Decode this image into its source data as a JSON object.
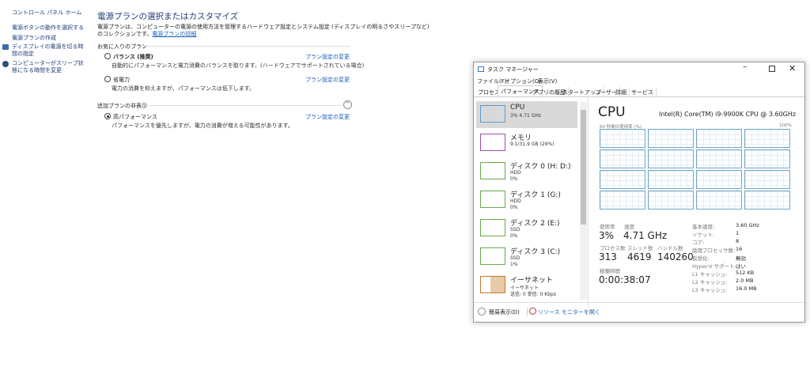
{
  "control_panel": {
    "sidebar": {
      "home": "コントロール パネル ホーム",
      "items": [
        "電源ボタンの動作を選択する",
        "電源プランの作成",
        "ディスプレイの電源を切る時間の指定",
        "コンピューターがスリープ状態になる時間を変更"
      ]
    },
    "title": "電源プランの選択またはカスタマイズ",
    "description": "電源プランは、コンピューターの電源の使用方法を管理するハードウェア設定とシステム設定 (ディスプレイの明るさやスリープなど)",
    "description2": "のコレクションです。",
    "details_link": "電源プランの詳細",
    "favorites_header": "お気に入りのプラン",
    "hidden_header": "追加プランの非表示",
    "change_link": "プラン設定の変更",
    "plans": [
      {
        "name": "バランス (推奨)",
        "desc": "自動的にパフォーマンスと電力消費のバランスを取ります。(ハードウェアでサポートされている場合)",
        "selected": false
      },
      {
        "name": "省電力",
        "desc": "電力の消費を抑えますが、パフォーマンスは低下します。",
        "selected": false
      },
      {
        "name": "高パフォーマンス",
        "desc": "パフォーマンスを優先しますが、電力の消費が増える可能性があります。",
        "selected": true
      }
    ]
  },
  "task_manager": {
    "title": "タスク マネージャー",
    "menu": [
      "ファイル(F)",
      "オプション(O)",
      "表示(V)"
    ],
    "tabs": [
      "プロセス",
      "パフォーマンス",
      "アプリの履歴",
      "スタートアップ",
      "ユーザー",
      "詳細",
      "サービス"
    ],
    "active_tab": "パフォーマンス",
    "resources": [
      {
        "name": "CPU",
        "sub1": "3% 4.71 GHz",
        "sub2": "",
        "color": "#5b9bc8"
      },
      {
        "name": "メモリ",
        "sub1": "9.1/31.9 GB (29%)",
        "sub2": "",
        "color": "#9b4ea8"
      },
      {
        "name": "ディスク 0 (H: D:)",
        "sub1": "HDD",
        "sub2": "0%",
        "color": "#6aa84f"
      },
      {
        "name": "ディスク 1 (G:)",
        "sub1": "HDD",
        "sub2": "0%",
        "color": "#6aa84f"
      },
      {
        "name": "ディスク 2 (E:)",
        "sub1": "SSD",
        "sub2": "0%",
        "color": "#6aa84f"
      },
      {
        "name": "ディスク 3 (C:)",
        "sub1": "SSD",
        "sub2": "1%",
        "color": "#6aa84f"
      },
      {
        "name": "イーサネット",
        "sub1": "イーサネット",
        "sub2": "送信: 0 受信: 0 Kbps",
        "color": "#c07a30"
      }
    ],
    "cpu": {
      "heading": "CPU",
      "model": "Intel(R) Core(TM) i9-9900K CPU @ 3.60GHz",
      "graph_label": "60 秒間の使用率 (%)",
      "graph_max": "100%",
      "usage_label": "使用率",
      "usage": "3%",
      "speed_label": "速度",
      "speed": "4.71 GHz",
      "proc_label": "プロセス数",
      "proc": "313",
      "thread_label": "スレッド数",
      "thread": "4619",
      "handle_label": "ハンドル数",
      "handle": "140260",
      "uptime_label": "稼働時間",
      "uptime": "0:00:38:07",
      "specs": [
        [
          "基本速度:",
          "3.60 GHz"
        ],
        [
          "ソケット:",
          "1"
        ],
        [
          "コア:",
          "8"
        ],
        [
          "論理プロセッサ数:",
          "16"
        ],
        [
          "仮想化:",
          "無効"
        ],
        [
          "Hyper-V サポート:",
          "はい"
        ],
        [
          "L1 キャッシュ:",
          "512 KB"
        ],
        [
          "L2 キャッシュ:",
          "2.0 MB"
        ],
        [
          "L3 キャッシュ:",
          "16.0 MB"
        ]
      ]
    },
    "fewer_details": "簡易表示(D)",
    "resource_monitor": "リソース モニターを開く"
  }
}
